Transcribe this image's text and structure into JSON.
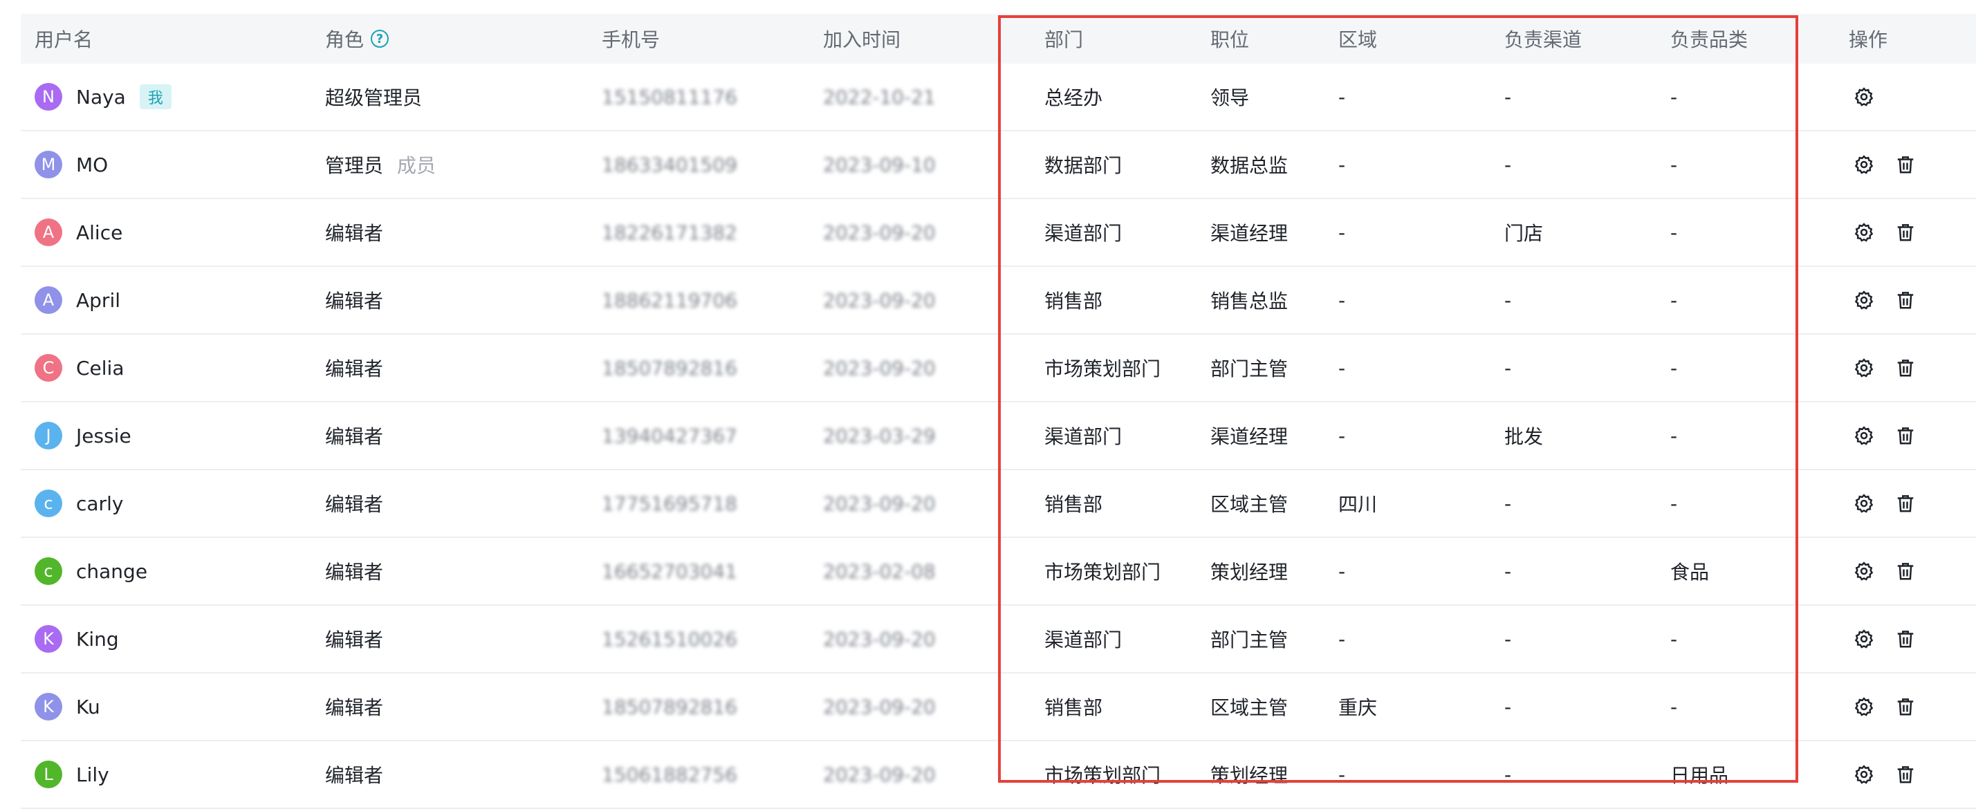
{
  "headers": {
    "user": "用户名",
    "role": "角色",
    "phone": "手机号",
    "join_time": "加入时间",
    "department": "部门",
    "position": "职位",
    "region": "区域",
    "channel": "负责渠道",
    "category": "负责品类",
    "actions": "操作"
  },
  "rows": [
    {
      "initial": "N",
      "color": "#a86bf2",
      "name": "Naya",
      "badge": "我",
      "role": "超级管理员",
      "role_sub": "",
      "phone": "15150811176",
      "date": "2022-10-21",
      "department": "总经办",
      "position": "领导",
      "region": "-",
      "channel": "-",
      "category": "-"
    },
    {
      "initial": "M",
      "color": "#8f92e8",
      "name": "MO",
      "badge": "",
      "role": "管理员",
      "role_sub": "成员",
      "phone": "18633401509",
      "date": "2023-09-10",
      "department": "数据部门",
      "position": "数据总监",
      "region": "-",
      "channel": "-",
      "category": "-"
    },
    {
      "initial": "A",
      "color": "#f07285",
      "name": "Alice",
      "badge": "",
      "role": "编辑者",
      "role_sub": "",
      "phone": "18226171382",
      "date": "2023-09-20",
      "department": "渠道部门",
      "position": "渠道经理",
      "region": "-",
      "channel": "门店",
      "category": "-"
    },
    {
      "initial": "A",
      "color": "#8f92e8",
      "name": "April",
      "badge": "",
      "role": "编辑者",
      "role_sub": "",
      "phone": "18862119706",
      "date": "2023-09-20",
      "department": "销售部",
      "position": "销售总监",
      "region": "-",
      "channel": "-",
      "category": "-"
    },
    {
      "initial": "C",
      "color": "#f07285",
      "name": "Celia",
      "badge": "",
      "role": "编辑者",
      "role_sub": "",
      "phone": "18507892816",
      "date": "2023-09-20",
      "department": "市场策划部门",
      "position": "部门主管",
      "region": "-",
      "channel": "-",
      "category": "-"
    },
    {
      "initial": "J",
      "color": "#5ab3ee",
      "name": "Jessie",
      "badge": "",
      "role": "编辑者",
      "role_sub": "",
      "phone": "13940427367",
      "date": "2023-03-29",
      "department": "渠道部门",
      "position": "渠道经理",
      "region": "-",
      "channel": "批发",
      "category": "-"
    },
    {
      "initial": "c",
      "color": "#5ab3ee",
      "name": "carly",
      "badge": "",
      "role": "编辑者",
      "role_sub": "",
      "phone": "17751695718",
      "date": "2023-09-20",
      "department": "销售部",
      "position": "区域主管",
      "region": "四川",
      "channel": "-",
      "category": "-"
    },
    {
      "initial": "c",
      "color": "#52b62a",
      "name": "change",
      "badge": "",
      "role": "编辑者",
      "role_sub": "",
      "phone": "16652703041",
      "date": "2023-02-08",
      "department": "市场策划部门",
      "position": "策划经理",
      "region": "-",
      "channel": "-",
      "category": "食品"
    },
    {
      "initial": "K",
      "color": "#a86bf2",
      "name": "King",
      "badge": "",
      "role": "编辑者",
      "role_sub": "",
      "phone": "15261510026",
      "date": "2023-09-20",
      "department": "渠道部门",
      "position": "部门主管",
      "region": "-",
      "channel": "-",
      "category": "-"
    },
    {
      "initial": "K",
      "color": "#8f92e8",
      "name": "Ku",
      "badge": "",
      "role": "编辑者",
      "role_sub": "",
      "phone": "18507892816",
      "date": "2023-09-20",
      "department": "销售部",
      "position": "区域主管",
      "region": "重庆",
      "channel": "-",
      "category": "-"
    },
    {
      "initial": "L",
      "color": "#52b62a",
      "name": "Lily",
      "badge": "",
      "role": "编辑者",
      "role_sub": "",
      "phone": "15061882756",
      "date": "2023-09-20",
      "department": "市场策划部门",
      "position": "策划经理",
      "region": "-",
      "channel": "-",
      "category": "日用品"
    }
  ],
  "icons": {
    "help": "question-icon",
    "settings": "gear-icon",
    "delete": "trash-icon"
  },
  "highlight_color": "#e5403b"
}
